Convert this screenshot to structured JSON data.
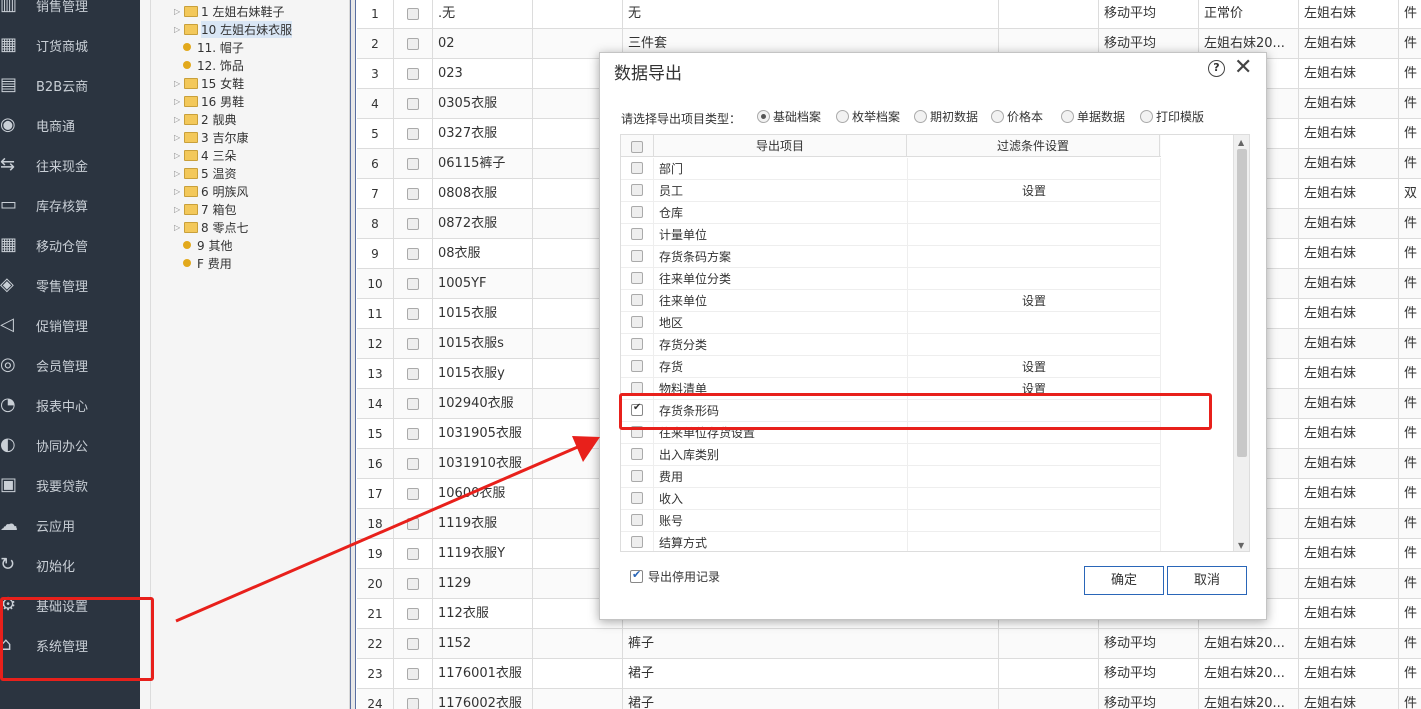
{
  "sidebar": {
    "items": [
      {
        "label": "销售管理",
        "icon": "sales-chart-icon"
      },
      {
        "label": "订货商城",
        "icon": "mall-icon"
      },
      {
        "label": "B2B云商",
        "icon": "b2b-icon"
      },
      {
        "label": "电商通",
        "icon": "ecommerce-icon"
      },
      {
        "label": "往来现金",
        "icon": "cash-flow-icon"
      },
      {
        "label": "库存核算",
        "icon": "inventory-icon"
      },
      {
        "label": "移动仓管",
        "icon": "mobile-warehouse-icon"
      },
      {
        "label": "零售管理",
        "icon": "retail-icon"
      },
      {
        "label": "促销管理",
        "icon": "promotion-icon"
      },
      {
        "label": "会员管理",
        "icon": "member-icon"
      },
      {
        "label": "报表中心",
        "icon": "report-icon"
      },
      {
        "label": "协同办公",
        "icon": "collab-icon"
      },
      {
        "label": "我要贷款",
        "icon": "loan-icon"
      },
      {
        "label": "云应用",
        "icon": "cloud-icon"
      },
      {
        "label": "初始化",
        "icon": "init-icon"
      },
      {
        "label": "基础设置",
        "icon": "settings-icon"
      },
      {
        "label": "系统管理",
        "icon": "system-icon"
      }
    ]
  },
  "tree": {
    "nodes": [
      {
        "label": "1 左姐右妹鞋子",
        "type": "folder"
      },
      {
        "label": "10 左姐右妹衣服",
        "type": "folder",
        "selected": true
      },
      {
        "label": "11. 帽子",
        "type": "leaf"
      },
      {
        "label": "12. 饰品",
        "type": "leaf"
      },
      {
        "label": "15 女鞋",
        "type": "folder"
      },
      {
        "label": "16 男鞋",
        "type": "folder"
      },
      {
        "label": "2 靓典",
        "type": "folder"
      },
      {
        "label": "3 吉尔康",
        "type": "folder"
      },
      {
        "label": "4 三朵",
        "type": "folder"
      },
      {
        "label": "5 温资",
        "type": "folder"
      },
      {
        "label": "6 明族风",
        "type": "folder"
      },
      {
        "label": "7 箱包",
        "type": "folder"
      },
      {
        "label": "8 零点七",
        "type": "folder"
      },
      {
        "label": "9 其他",
        "type": "leaf"
      },
      {
        "label": "F 费用",
        "type": "leaf"
      }
    ]
  },
  "grid": {
    "rows": [
      {
        "n": "1",
        "code": ".无",
        "name": "无",
        "cost": "移动平均",
        "price": "正常价",
        "brand": "左姐右妹",
        "unit": "件"
      },
      {
        "n": "2",
        "code": "02",
        "name": "三件套",
        "cost": "移动平均",
        "price": "左姐右妹20...",
        "brand": "左姐右妹",
        "unit": "件"
      },
      {
        "n": "3",
        "code": "023",
        "name": "",
        "cost": "",
        "price": "",
        "brand": "左姐右妹",
        "unit": "件"
      },
      {
        "n": "4",
        "code": "0305衣服",
        "name": "",
        "cost": "",
        "price": "",
        "brand": "左姐右妹",
        "unit": "件"
      },
      {
        "n": "5",
        "code": "0327衣服",
        "name": "",
        "cost": "",
        "price": "",
        "brand": "左姐右妹",
        "unit": "件"
      },
      {
        "n": "6",
        "code": "06115裤子",
        "name": "",
        "cost": "",
        "price": "",
        "brand": "左姐右妹",
        "unit": "件"
      },
      {
        "n": "7",
        "code": "0808衣服",
        "name": "",
        "cost": "",
        "price": "",
        "brand": "左姐右妹",
        "unit": "双"
      },
      {
        "n": "8",
        "code": "0872衣服",
        "name": "",
        "cost": "",
        "price": "",
        "brand": "左姐右妹",
        "unit": "件"
      },
      {
        "n": "9",
        "code": "08衣服",
        "name": "",
        "cost": "",
        "price": "",
        "brand": "左姐右妹",
        "unit": "件"
      },
      {
        "n": "10",
        "code": "1005YF",
        "name": "",
        "cost": "",
        "price": "",
        "brand": "左姐右妹",
        "unit": "件"
      },
      {
        "n": "11",
        "code": "1015衣服",
        "name": "",
        "cost": "",
        "price": "",
        "brand": "左姐右妹",
        "unit": "件"
      },
      {
        "n": "12",
        "code": "1015衣服s",
        "name": "",
        "cost": "",
        "price": "",
        "brand": "左姐右妹",
        "unit": "件"
      },
      {
        "n": "13",
        "code": "1015衣服y",
        "name": "",
        "cost": "",
        "price": "",
        "brand": "左姐右妹",
        "unit": "件"
      },
      {
        "n": "14",
        "code": "102940衣服",
        "name": "",
        "cost": "",
        "price": "",
        "brand": "左姐右妹",
        "unit": "件"
      },
      {
        "n": "15",
        "code": "1031905衣服",
        "name": "",
        "cost": "",
        "price": "",
        "brand": "左姐右妹",
        "unit": "件"
      },
      {
        "n": "16",
        "code": "1031910衣服",
        "name": "",
        "cost": "",
        "price": "",
        "brand": "左姐右妹",
        "unit": "件"
      },
      {
        "n": "17",
        "code": "10600衣服",
        "name": "",
        "cost": "",
        "price": "",
        "brand": "左姐右妹",
        "unit": "件"
      },
      {
        "n": "18",
        "code": "1119衣服",
        "name": "",
        "cost": "",
        "price": "",
        "brand": "左姐右妹",
        "unit": "件"
      },
      {
        "n": "19",
        "code": "1119衣服Y",
        "name": "",
        "cost": "",
        "price": "",
        "brand": "左姐右妹",
        "unit": "件"
      },
      {
        "n": "20",
        "code": "1129",
        "name": "",
        "cost": "",
        "price": "",
        "brand": "左姐右妹",
        "unit": "件"
      },
      {
        "n": "21",
        "code": "112衣服",
        "name": "",
        "cost": "",
        "price": "",
        "brand": "左姐右妹",
        "unit": "件"
      },
      {
        "n": "22",
        "code": "1152",
        "name": "裤子",
        "cost": "移动平均",
        "price": "左姐右妹20...",
        "brand": "左姐右妹",
        "unit": "件"
      },
      {
        "n": "23",
        "code": "1176001衣服",
        "name": "裙子",
        "cost": "移动平均",
        "price": "左姐右妹20...",
        "brand": "左姐右妹",
        "unit": "件"
      },
      {
        "n": "24",
        "code": "1176002衣服",
        "name": "裙子",
        "cost": "移动平均",
        "price": "左姐右妹20...",
        "brand": "左姐右妹",
        "unit": "件"
      }
    ]
  },
  "dialog": {
    "title": "数据导出",
    "help_glyph": "?",
    "close_glyph": "✕",
    "type_label": "请选择导出项目类型：",
    "radios": [
      {
        "label": "基础档案",
        "checked": true
      },
      {
        "label": "枚举档案",
        "checked": false
      },
      {
        "label": "期初数据",
        "checked": false
      },
      {
        "label": "价格本",
        "checked": false
      },
      {
        "label": "单据数据",
        "checked": false
      },
      {
        "label": "打印模版",
        "checked": false
      }
    ],
    "col_item": "导出项目",
    "col_filter": "过滤条件设置",
    "items": [
      {
        "name": "部门",
        "setting": "",
        "checked": false
      },
      {
        "name": "员工",
        "setting": "设置",
        "checked": false
      },
      {
        "name": "仓库",
        "setting": "",
        "checked": false
      },
      {
        "name": "计量单位",
        "setting": "",
        "checked": false
      },
      {
        "name": "存货条码方案",
        "setting": "",
        "checked": false
      },
      {
        "name": "往来单位分类",
        "setting": "",
        "checked": false
      },
      {
        "name": "往来单位",
        "setting": "设置",
        "checked": false
      },
      {
        "name": "地区",
        "setting": "",
        "checked": false
      },
      {
        "name": "存货分类",
        "setting": "",
        "checked": false
      },
      {
        "name": "存货",
        "setting": "设置",
        "checked": false
      },
      {
        "name": "物料清单",
        "setting": "设置",
        "checked": false
      },
      {
        "name": "存货条形码",
        "setting": "",
        "checked": true
      },
      {
        "name": "往来单位存货设置",
        "setting": "",
        "checked": false
      },
      {
        "name": "出入库类别",
        "setting": "",
        "checked": false
      },
      {
        "name": "费用",
        "setting": "",
        "checked": false
      },
      {
        "name": "收入",
        "setting": "",
        "checked": false
      },
      {
        "name": "账号",
        "setting": "",
        "checked": false
      },
      {
        "name": "结算方式",
        "setting": "",
        "checked": false
      }
    ],
    "export_stopped_label": "导出停用记录",
    "export_stopped_checked": true,
    "ok_label": "确定",
    "cancel_label": "取消"
  },
  "colors": {
    "sidebar_bg": "#2b3440",
    "annotation_red": "#e8201b",
    "button_border": "#2a66b8"
  }
}
